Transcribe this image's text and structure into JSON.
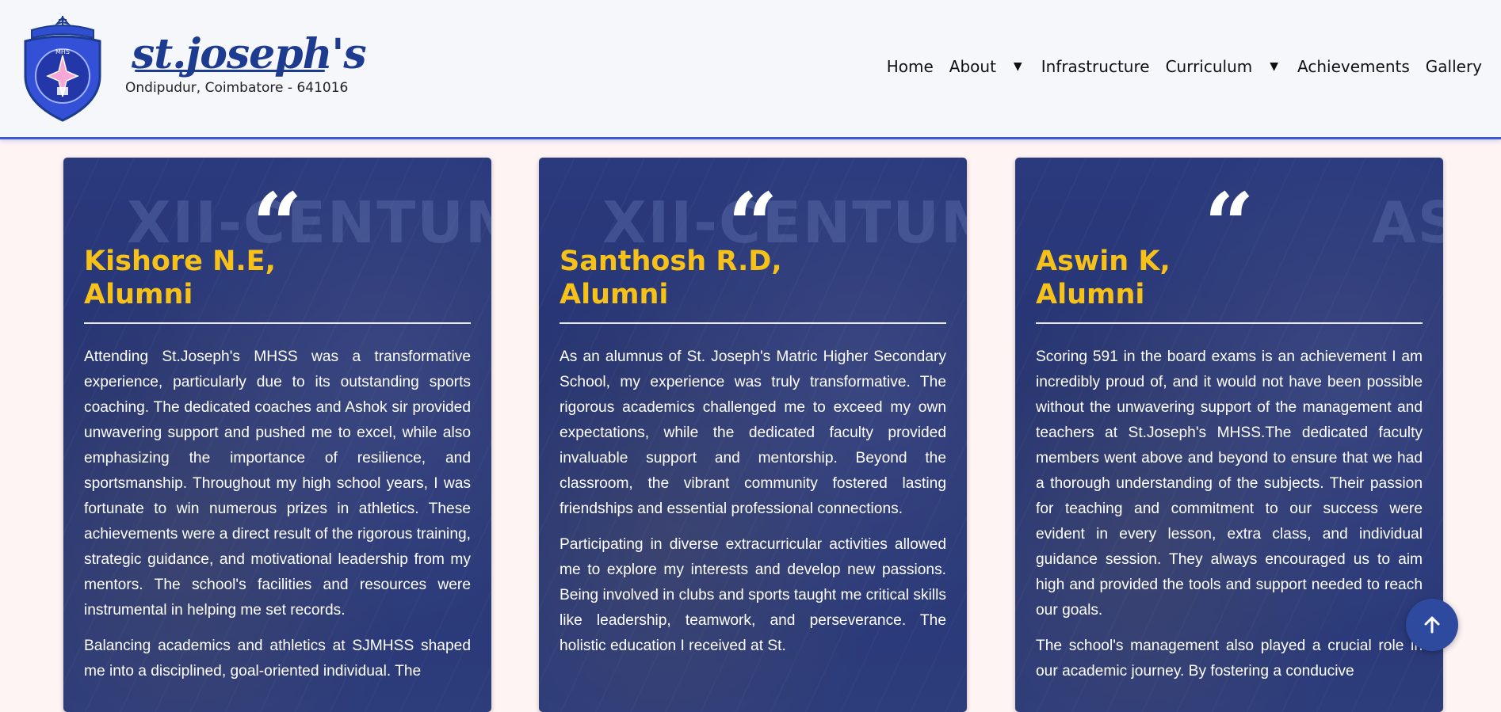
{
  "header": {
    "brand_name": "st.joseph's",
    "address": "Ondipudur, Coimbatore - 641016",
    "crest_letters": "MHS"
  },
  "nav": {
    "items": [
      "Home",
      "About",
      "Infrastructure",
      "Curriculum",
      "Achievements",
      "Gallery"
    ]
  },
  "cards": [
    {
      "name_line1": "Kishore N.E,",
      "name_line2": "Alumni",
      "background_text": "XII-CENTUM",
      "paragraphs": [
        "Attending St.Joseph's MHSS was a transformative experience, particularly due to its outstanding sports coaching. The dedicated coaches and Ashok sir provided unwavering support and pushed me to excel, while also emphasizing the importance of resilience, and sportsmanship. Throughout my high school years, I was fortunate to win numerous prizes in athletics. These achievements were a direct result of the rigorous training, strategic guidance, and motivational leadership from my mentors. The school's facilities and resources were instrumental in helping me set records.",
        "Balancing academics and athletics at SJMHSS shaped me into a disciplined, goal-oriented individual. The"
      ]
    },
    {
      "name_line1": "Santhosh R.D,",
      "name_line2": "Alumni",
      "background_text": "XII-CENTUM",
      "paragraphs": [
        "As an alumnus of St. Joseph's Matric Higher Secondary School, my experience was truly transformative. The rigorous academics challenged me to exceed my own expectations, while the dedicated faculty provided invaluable support and mentorship. Beyond the classroom, the vibrant community fostered lasting friendships and essential professional connections.",
        "Participating in diverse extracurricular activities allowed me to explore my interests and develop new passions. Being involved in clubs and sports taught me critical skills like leadership, teamwork, and perseverance. The holistic education I received at St."
      ]
    },
    {
      "name_line1": "Aswin K,",
      "name_line2": "Alumni",
      "background_text": "AS",
      "paragraphs": [
        "Scoring 591 in the board exams is an achievement I am incredibly proud of, and it would not have been possible without the unwavering support of the management and teachers at St.Joseph's MHSS.The dedicated faculty members went above and beyond to ensure that we had a thorough understanding of the subjects. Their passion for teaching and commitment to our success were evident in every lesson, extra class, and individual guidance session. They always encouraged us to aim high and provided the tools and support needed to reach our goals.",
        "The school's management also played a crucial role in our academic journey. By fostering a conducive"
      ]
    }
  ],
  "colors": {
    "brand_blue": "#1d3b8f",
    "name_gold": "#f6c21a",
    "scroll_button": "#2e4a9e"
  }
}
